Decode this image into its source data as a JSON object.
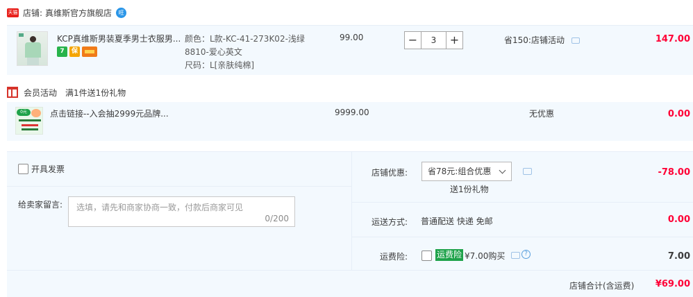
{
  "shop": {
    "logo_text": "天猫",
    "label": "店铺:",
    "name": "真维斯官方旗舰店",
    "chat_icon": "wangwang-chat-icon",
    "chat_glyph": "旺"
  },
  "item": {
    "title": "KCP真维斯男装夏季男士衣服男...",
    "badges": [
      "7",
      "保",
      "card"
    ],
    "sku_lines": [
      "颜色：L款-KC-41-273K02-浅绿",
      "8810-爱心英文",
      "尺码：L[亲肤纯棉]"
    ],
    "price": "99.00",
    "quantity": "3",
    "minus_label": "−",
    "plus_label": "+",
    "promo": "省150:店铺活动",
    "total": "147.00"
  },
  "member": {
    "label": "会员活动",
    "desc": "满1件送1份礼物"
  },
  "gift": {
    "img_tag": "0元",
    "title": "点击链接--入会抽2999元品牌...",
    "price": "9999.00",
    "promo": "无优惠",
    "total": "0.00"
  },
  "summary": {
    "invoice_label": "开具发票",
    "memo_label": "给卖家留言:",
    "memo_placeholder": "选填，请先和商家协商一致，付款后商家可见",
    "memo_count": "0/200",
    "discount_label": "店铺优惠:",
    "discount_selected": "省78元:组合优惠",
    "discount_note": "送1份礼物",
    "discount_value": "-78.00",
    "shipping_label": "运送方式:",
    "shipping_method": "普通配送 快递 免邮",
    "shipping_value": "0.00",
    "insurance_label": "运费险:",
    "insurance_tag": "运费险",
    "insurance_price": "¥7.00购买",
    "insurance_value": "7.00",
    "total_label": "店铺合计(含运费)",
    "total_value": "¥69.00"
  },
  "colors": {
    "accent_red": "#ff0036",
    "row_bg": "#f3f9fe",
    "tmall_red": "#e8211c",
    "insurance_green": "#1ea24a"
  }
}
